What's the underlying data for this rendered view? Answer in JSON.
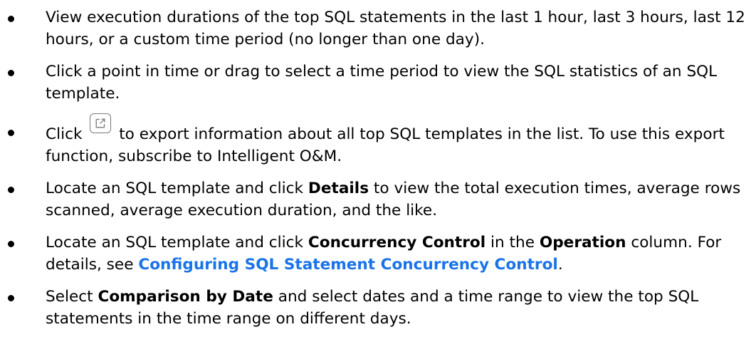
{
  "bullets": {
    "b1": {
      "text": "View execution durations of the top SQL statements in the last 1 hour, last 3 hours, last 12 hours, or a custom time period (no longer than one day)."
    },
    "b2": {
      "text": "Click a point in time or drag to select a time period to view the SQL statistics of an SQL template."
    },
    "b3": {
      "pre": "Click ",
      "icon": "export-icon",
      "post": " to export information about all top SQL templates in the list. To use this export function, subscribe to Intelligent O&M."
    },
    "b4": {
      "pre": "Locate an SQL template and click ",
      "bold": "Details",
      "post": " to view the total execution times, average rows scanned, average execution duration, and the like."
    },
    "b5": {
      "pre": "Locate an SQL template and click ",
      "bold1": "Concurrency Control",
      "mid": " in the ",
      "bold2": "Operation",
      "mid2": " column. For details, see ",
      "link": "Configuring SQL Statement Concurrency Control",
      "end": "."
    },
    "b6": {
      "pre": "Select ",
      "bold": "Comparison by Date",
      "post": " and select dates and a time range to view the top SQL statements in the time range on different days."
    }
  },
  "colors": {
    "link": "#1a73e8",
    "text": "#000000"
  }
}
